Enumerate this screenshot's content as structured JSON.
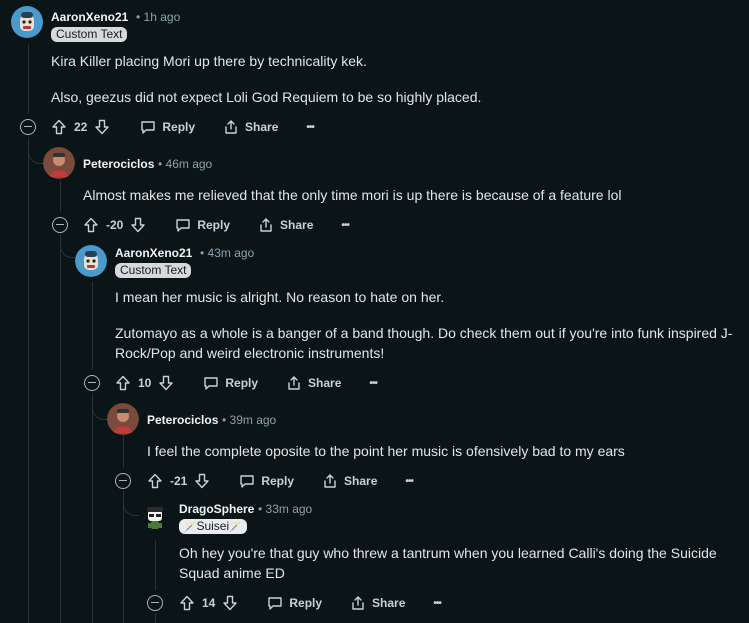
{
  "comments": [
    {
      "author": "AaronXeno21",
      "time": "• 1h ago",
      "flair": "Custom Text",
      "paragraphs": [
        "Kira Killer placing Mori up there by technicality kek.",
        "Also, geezus did not expect Loli God Requiem to be so highly placed."
      ],
      "votes": "22",
      "reply_label": "Reply",
      "share_label": "Share",
      "more_label": "•••"
    },
    {
      "author": "Peterociclos",
      "time": "• 46m ago",
      "paragraphs": [
        "Almost makes me relieved that the only time mori is up there is because of a feature lol"
      ],
      "votes": "-20",
      "reply_label": "Reply",
      "share_label": "Share",
      "more_label": "•••"
    },
    {
      "author": "AaronXeno21",
      "time": "• 43m ago",
      "flair": "Custom Text",
      "paragraphs": [
        "I mean her music is alright. No reason to hate on her.",
        "Zutomayo as a whole is a banger of a band though. Do check them out if you're into funk inspired J-Rock/Pop and weird electronic instruments!"
      ],
      "votes": "10",
      "reply_label": "Reply",
      "share_label": "Share",
      "more_label": "•••"
    },
    {
      "author": "Peterociclos",
      "time": "• 39m ago",
      "paragraphs": [
        "I feel the complete oposite to the point her music is ofensively bad to my ears"
      ],
      "votes": "-21",
      "reply_label": "Reply",
      "share_label": "Share",
      "more_label": "•••"
    },
    {
      "author": "DragoSphere",
      "time": "• 33m ago",
      "flair": "Suisei",
      "flair_emoji_left": "🪄",
      "flair_emoji_right": "🪄",
      "paragraphs": [
        "Oh hey you're that guy who threw a tantrum when you learned Calli's doing the Suicide Squad anime ED"
      ],
      "votes": "14",
      "reply_label": "Reply",
      "share_label": "Share",
      "more_label": "•••"
    }
  ],
  "icons": {
    "upvote": "arrow-up-icon",
    "downvote": "arrow-down-icon",
    "reply": "chat-bubble-icon",
    "share": "share-icon",
    "collapse": "collapse-minus-icon"
  },
  "colors": {
    "background": "#0b1416",
    "thread_line": "#2a3236",
    "flair_bg": "#d7dadc",
    "flair_blue": "#3b82f6"
  }
}
